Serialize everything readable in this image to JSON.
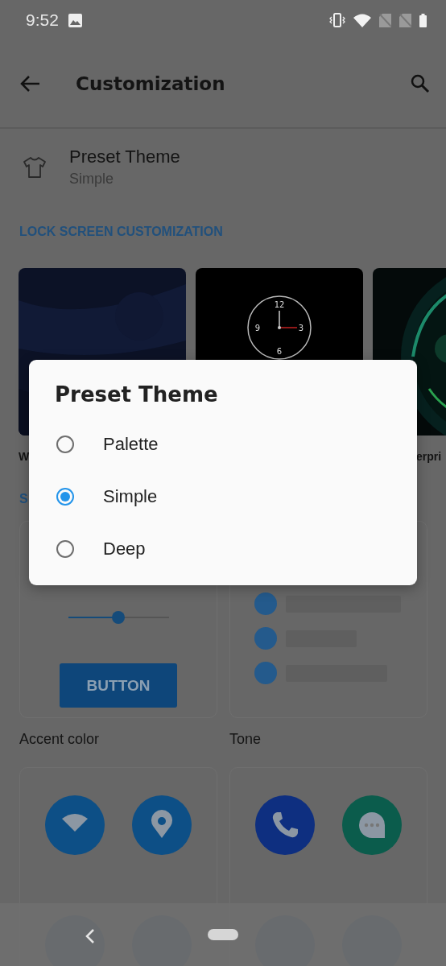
{
  "status_bar": {
    "time": "9:52"
  },
  "toolbar": {
    "title": "Customization"
  },
  "preset_row": {
    "title": "Preset Theme",
    "value": "Simple"
  },
  "lock_section": {
    "header": "LOCK SCREEN CUSTOMIZATION",
    "cards": [
      {
        "kind": "picture",
        "label": "W"
      },
      {
        "kind": "clock",
        "numerals": [
          "12",
          "3",
          "6",
          "9"
        ]
      },
      {
        "kind": "picture",
        "label": "erpri"
      }
    ]
  },
  "style_section": {
    "header": "S",
    "previews": [
      {
        "kind": "accent",
        "label": "Accent color",
        "slider": {
          "level": 0.5
        },
        "button": "BUTTON"
      },
      {
        "kind": "tone",
        "label": "Tone"
      }
    ],
    "icon_cards": [
      {
        "icons": [
          {
            "kind": "wifi",
            "color": "#0d4f86"
          },
          {
            "kind": "location",
            "color": "#0d4f86"
          }
        ]
      },
      {
        "icons": [
          {
            "kind": "phone",
            "color": "#0e2f80"
          },
          {
            "kind": "message",
            "color": "#0b5c4c"
          }
        ]
      }
    ]
  },
  "dialog": {
    "title": "Preset Theme",
    "options": [
      {
        "label": "Palette",
        "selected": false
      },
      {
        "label": "Simple",
        "selected": true
      },
      {
        "label": "Deep",
        "selected": false
      }
    ]
  }
}
